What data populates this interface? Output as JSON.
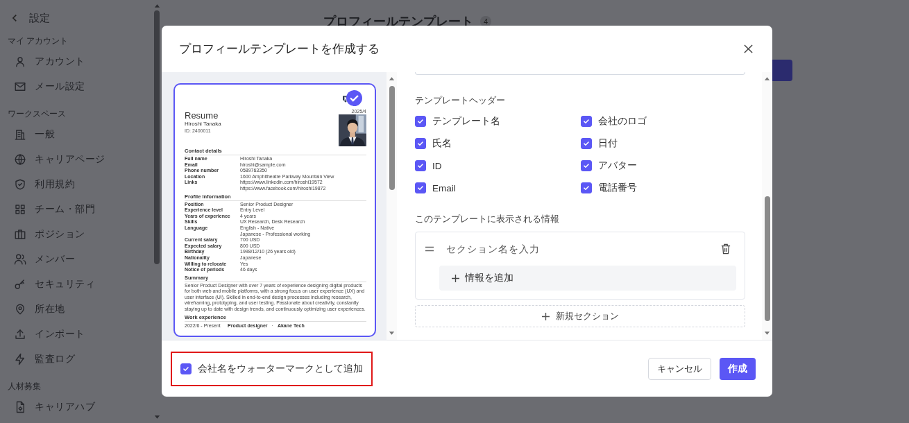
{
  "sidebar": {
    "back_label": "設定",
    "groups": [
      {
        "title": "マイ アカウント",
        "items": [
          {
            "label": "アカウント"
          },
          {
            "label": "メール設定"
          }
        ]
      },
      {
        "title": "ワークスペース",
        "items": [
          {
            "label": "一般"
          },
          {
            "label": "キャリアページ"
          },
          {
            "label": "利用規約"
          },
          {
            "label": "チーム・部門"
          },
          {
            "label": "ポジション"
          },
          {
            "label": "メンバー"
          },
          {
            "label": "セキュリティ"
          },
          {
            "label": "所在地"
          },
          {
            "label": "インポート"
          },
          {
            "label": "監査ログ"
          }
        ]
      },
      {
        "title": "人材募集",
        "items": [
          {
            "label": "キャリアハブ"
          }
        ]
      }
    ]
  },
  "page": {
    "title": "プロフィールテンプレート",
    "count": "4"
  },
  "modal": {
    "title": "プロフィールテンプレートを作成する",
    "preview": {
      "selected": true,
      "date": "2025/4",
      "title": "Resume",
      "name": "Hiroshi Tanaka",
      "id": "ID: 2400011",
      "sections": [
        {
          "kind": "fields",
          "title": "Contact details",
          "rows": [
            {
              "label": "Full name",
              "values": [
                "Hiroshi Tanaka"
              ]
            },
            {
              "label": "Email",
              "values": [
                "hiroshi@sample.com"
              ]
            },
            {
              "label": "Phone number",
              "values": [
                "0589763350"
              ]
            },
            {
              "label": "Location",
              "values": [
                "1600 Amphitheatre Parkway Mountain View"
              ]
            },
            {
              "label": "Links",
              "values": [
                "https://www.linkedin.com/hiroshi19572",
                "https://www.facebook.com/hiroshi19872"
              ]
            }
          ]
        },
        {
          "kind": "fields",
          "title": "Profile Information",
          "rows": [
            {
              "label": "Position",
              "values": [
                "Senior Product Designer"
              ]
            },
            {
              "label": "Experience level",
              "values": [
                "Entry Level"
              ]
            },
            {
              "label": "Years of experience",
              "values": [
                "4 years"
              ]
            },
            {
              "label": "Skills",
              "values": [
                "UX Research, Desk Research"
              ]
            },
            {
              "label": "Language",
              "values": [
                "English - Native",
                "Japanese - Professional working"
              ]
            },
            {
              "label": "Current salary",
              "values": [
                "700 USD"
              ]
            },
            {
              "label": "Expected salary",
              "values": [
                "800 USD"
              ]
            },
            {
              "label": "Birthday",
              "values": [
                "1998/12/10 (26 years old)"
              ]
            },
            {
              "label": "Nationality",
              "values": [
                "Japanese"
              ]
            },
            {
              "label": "Willing to relocate",
              "values": [
                "Yes"
              ]
            },
            {
              "label": "Notice of periods",
              "values": [
                "46 days"
              ]
            }
          ]
        },
        {
          "kind": "text",
          "title": "Summary",
          "text": "Senior Product Designer with over 7 years of experience designing digital products for both web and mobile platforms, with a strong focus on user experience (UX) and user interface (UI). Skilled in end-to-end design processes including research, wireframing, prototyping, and user testing. Passionate about creativity, constantly staying up to date with design trends, and continuously optimizing user experiences."
        },
        {
          "kind": "work",
          "title": "Work experience",
          "entries": [
            {
              "period": "2022/6 - Present",
              "role": "Product designer",
              "separator": "·",
              "company": "Akane Tech"
            }
          ]
        }
      ]
    },
    "header_section": {
      "title": "テンプレートヘッダー",
      "options": [
        {
          "label": "テンプレート名",
          "checked": true
        },
        {
          "label": "会社のロゴ",
          "checked": true
        },
        {
          "label": "氏名",
          "checked": true
        },
        {
          "label": "日付",
          "checked": true
        },
        {
          "label": "ID",
          "checked": true
        },
        {
          "label": "アバター",
          "checked": true
        },
        {
          "label": "Email",
          "checked": true
        },
        {
          "label": "電話番号",
          "checked": true
        }
      ]
    },
    "info_section": {
      "title": "このテンプレートに表示される情報",
      "sections": [
        {
          "placeholder": "セクション名を入力",
          "add_label": "情報を追加"
        }
      ],
      "new_section_label": "新規セクション"
    },
    "watermark": {
      "label": "会社名をウォーターマークとして追加",
      "checked": true,
      "highlighted": true
    },
    "buttons": {
      "cancel": "キャンセル",
      "create": "作成"
    }
  }
}
